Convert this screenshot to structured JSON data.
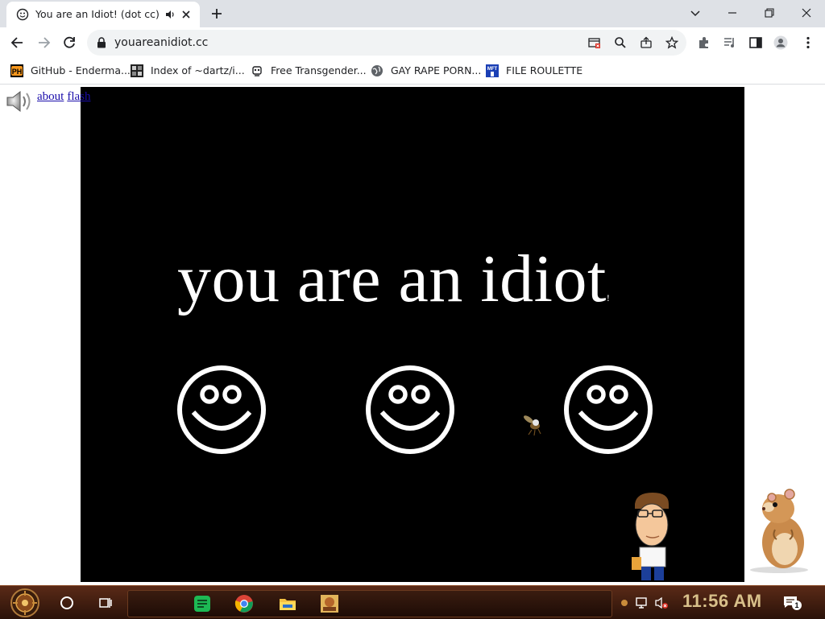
{
  "browser": {
    "tab": {
      "title": "You are an Idiot! (dot cc)"
    },
    "address": {
      "url": "youareanidiot.cc"
    },
    "bookmarks": [
      {
        "label": "GitHub - Enderma...",
        "icon": "ph-icon"
      },
      {
        "label": "Index of ~dartz/i...",
        "icon": "index-icon"
      },
      {
        "label": "Free Transgender...",
        "icon": "bot-icon"
      },
      {
        "label": "GAY RAPE PORN...",
        "icon": "globe-icon"
      },
      {
        "label": "FILE ROULETTE",
        "icon": "mft-icon"
      }
    ]
  },
  "page": {
    "links": {
      "about": "about",
      "flash": "flash"
    },
    "headline": "you are an idiot",
    "headline_suffix": "!"
  },
  "taskbar": {
    "clock": "11:56 AM",
    "notification_count": "1"
  }
}
